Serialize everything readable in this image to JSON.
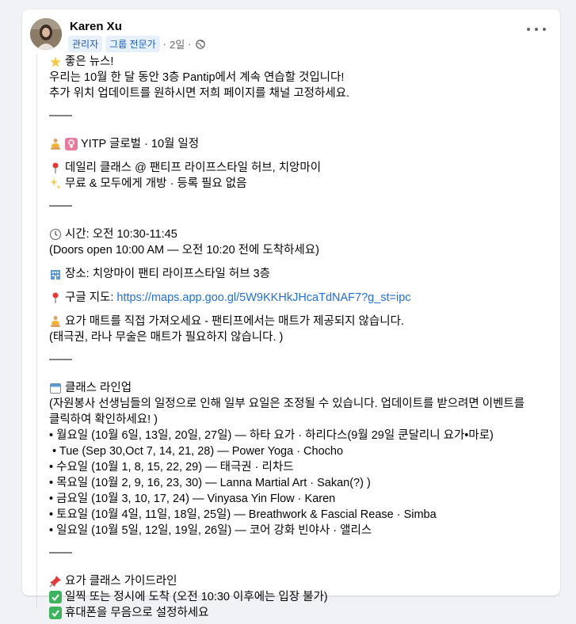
{
  "author": {
    "name": "Karen Xu",
    "badges": [
      "관리자",
      "그룹 전문가"
    ],
    "separator": "·",
    "time": "2일",
    "time_separator": "·"
  },
  "post": {
    "l1": "좋은 뉴스!",
    "l2": "우리는 10월 한 달 동안 3층 Pantip에서 계속 연습할 것입니다!",
    "l3": "추가 위치 업데이트를 원하시면 저희 페이지를 채널 고정하세요.",
    "divider": "——",
    "title": "YITP 글로벌 · 10월 일정",
    "venue": "데일리 클래스 @ 팬티프 라이프스타일 허브, 치앙마이",
    "free": "무료 & 모두에게 개방 · 등록 필요 없음",
    "time": "시간: 오전 10:30-11:45",
    "doors": "(Doors open 10:00 AM — 오전 10:20 전에 도착하세요)",
    "place": "장소: 치앙마이 팬티 라이프스타일 허브 3층",
    "map_label": "구글 지도:",
    "map_url": "https://maps.app.goo.gl/5W9KKHkJHcaTdNAF7?g_st=ipc",
    "mat": "요가 매트를 직접 가져오세요 - 팬티프에서는 매트가 제공되지 않습니다.",
    "mat_note": "(태극권, 라나 무술은 매트가 필요하지 않습니다. )",
    "lineup_title": "클래스 라인업",
    "lineup_note_1": "(자원봉사 선생님들의 일정으로 인해 일부 요일은 조정될 수 있습니다. 업데이트를 받으려면 이벤트를",
    "lineup_note_2": "클릭하여 확인하세요! )",
    "schedule": [
      "• 월요일 (10월 6일, 13일, 20일, 27일) — 하타 요가 · 하리다스(9월 29일 쿤달리니 요가•마로)",
      " • Tue (Sep 30,Oct 7, 14, 21, 28) — Power Yoga · Chocho",
      "• 수요일 (10월 1, 8, 15, 22, 29) — 태극권 · 리차드",
      "• 목요일 (10월 2, 9, 16, 23, 30) — Lanna Martial Art · Sakan(?) )",
      "• 금요일 (10월 3, 10, 17, 24) — Vinyasa Yin Flow · Karen",
      "• 토요일 (10월 4일, 11일, 18일, 25일) — Breathwork & Fascial Rease · Simba",
      "• 일요일 (10월 5일, 12일, 19일, 26일) — 코어 강화 빈야사 · 앨리스"
    ],
    "guide_title": "요가 클래스 가이드라인",
    "guide_1": "일찍 또는 정시에 도착 (오전 10:30 이후에는 입장 불가)",
    "guide_2": "휴대폰을 무음으로 설정하세요"
  },
  "colors": {
    "link": "#216fdb",
    "badge_bg": "#e7f0fd",
    "badge_text": "#1b5fbf",
    "check": "#3db35d"
  }
}
